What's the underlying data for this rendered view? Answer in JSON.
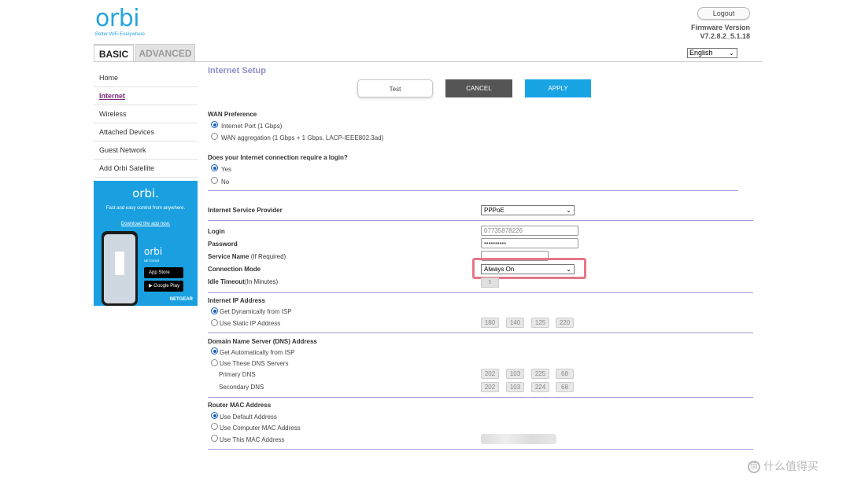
{
  "header": {
    "logo_text": "orbi",
    "logo_tagline": "Better WiFi Everywhere",
    "logout_label": "Logout",
    "firmware_label": "Firmware Version",
    "firmware_value": "V7.2.8.2_5.1.18",
    "language": "English"
  },
  "tabs": {
    "basic": "BASIC",
    "advanced": "ADVANCED"
  },
  "sidebar": {
    "items": [
      {
        "label": "Home"
      },
      {
        "label": "Internet"
      },
      {
        "label": "Wireless"
      },
      {
        "label": "Attached Devices"
      },
      {
        "label": "Guest Network"
      },
      {
        "label": "Add Orbi Satellite"
      }
    ]
  },
  "promo": {
    "logo": "orbi.",
    "text": "Fast and easy control from anywhere.",
    "link": "Download the app now.",
    "mini_logo": "orbi",
    "mini_brand": "NETGEAR",
    "app_store": "App Store",
    "google_play": "Google Play",
    "brand": "NETGEAR"
  },
  "main": {
    "title": "Internet Setup",
    "buttons": {
      "test": "Test",
      "cancel": "CANCEL",
      "apply": "APPLY"
    },
    "wan": {
      "heading": "WAN Preference",
      "opt1": "Internet Port (1 Gbps)",
      "opt2": "WAN aggregation (1 Gbps + 1 Gbps, LACP-IEEE802.3ad)"
    },
    "login_q": {
      "heading": "Does your Internet connection require a login?",
      "yes": "Yes",
      "no": "No"
    },
    "isp": {
      "label": "Internet Service Provider",
      "value": "PPPoE"
    },
    "login": {
      "label": "Login",
      "value": "07735878226"
    },
    "password": {
      "label": "Password",
      "value": "••••••••••"
    },
    "service_name": {
      "label": "Service Name",
      "suffix": "(If Required)"
    },
    "connection_mode": {
      "label": "Connection Mode",
      "value": "Always On"
    },
    "idle_timeout": {
      "label": "Idle Timeout",
      "suffix": "(In Minutes)",
      "value": "5"
    },
    "ip": {
      "heading": "Internet IP Address",
      "opt1": "Get Dynamically from ISP",
      "opt2": "Use Static IP Address",
      "octets": [
        "180",
        "140",
        "125",
        "220"
      ]
    },
    "dns": {
      "heading": "Domain Name Server (DNS) Address",
      "opt1": "Get Automatically from ISP",
      "opt2": "Use These DNS Servers",
      "primary_label": "Primary DNS",
      "primary": [
        "202",
        "103",
        "225",
        "68"
      ],
      "secondary_label": "Secondary DNS",
      "secondary": [
        "202",
        "103",
        "224",
        "68"
      ]
    },
    "mac": {
      "heading": "Router MAC Address",
      "opt1": "Use Default Address",
      "opt2": "Use Computer MAC Address",
      "opt3": "Use This MAC Address"
    }
  },
  "watermark": {
    "icon": "值",
    "text": "什么值得买"
  },
  "colors": {
    "accent": "#19a4e4",
    "title": "#8e8ec6",
    "rule": "#a79ad9",
    "highlight": "#e57788",
    "active_nav": "#7a2a7c"
  }
}
